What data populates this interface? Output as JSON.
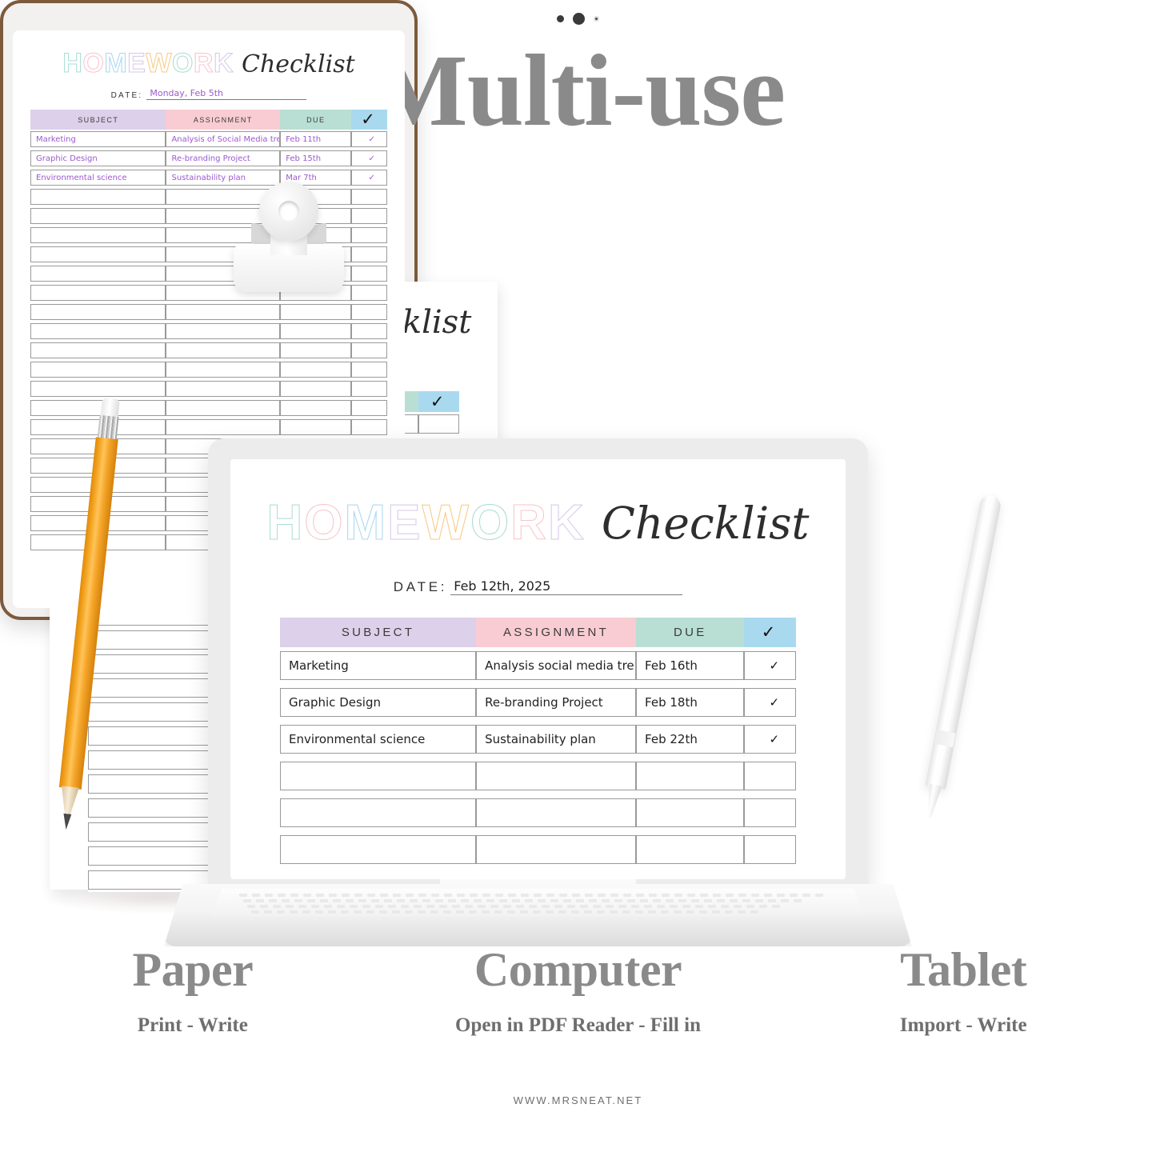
{
  "headline": "Multi-use",
  "footer": "WWW.MRSNEAT.NET",
  "brand_colors": {
    "letter_mint": "#a8ddd2",
    "letter_pink": "#f8c3cd",
    "letter_blue": "#a9d6ef",
    "letter_lavender": "#d5c7e8",
    "letter_orange": "#f8c882",
    "header_subject": "#ddd0ea",
    "header_assignment": "#f9ccd3",
    "header_due": "#b9dfd4",
    "header_check": "#a9d9ef",
    "handwriting_purple": "#9b59d0",
    "headline_gray": "#8a8a8a",
    "tablet_frame": "#7d5a3c"
  },
  "worksheet": {
    "title_letters": [
      {
        "char": "H",
        "color": "#a8ddd2"
      },
      {
        "char": "O",
        "color": "#f8c3cd"
      },
      {
        "char": "M",
        "color": "#a9d6ef"
      },
      {
        "char": "E",
        "color": "#d5c7e8"
      },
      {
        "char": "W",
        "color": "#f8c882"
      },
      {
        "char": "O",
        "color": "#a8ddd2"
      },
      {
        "char": "R",
        "color": "#f8c3cd"
      },
      {
        "char": "K",
        "color": "#d5c7e8"
      }
    ],
    "script_word": "Checklist",
    "date_label": "DATE:",
    "columns": [
      "SUBJECT",
      "ASSIGNMENT",
      "DUE",
      "✓"
    ]
  },
  "paper": {
    "caption_title": "Paper",
    "caption_sub": "Print - Write",
    "date_value": "",
    "rows": [
      {
        "subject": "",
        "assignment": "",
        "due": "",
        "done": ""
      },
      {
        "subject": "",
        "assignment": "",
        "due": "",
        "done": ""
      },
      {
        "subject": "",
        "assignment": "",
        "due": "",
        "done": ""
      },
      {
        "subject": "",
        "assignment": "",
        "due": "",
        "done": ""
      },
      {
        "subject": "",
        "assignment": "",
        "due": "",
        "done": ""
      },
      {
        "subject": "",
        "assignment": "",
        "due": "",
        "done": ""
      },
      {
        "subject": "",
        "assignment": "",
        "due": "",
        "done": ""
      },
      {
        "subject": "",
        "assignment": "",
        "due": "",
        "done": ""
      },
      {
        "subject": "",
        "assignment": "",
        "due": "",
        "done": ""
      },
      {
        "subject": "",
        "assignment": "",
        "due": "",
        "done": ""
      },
      {
        "subject": "",
        "assignment": "",
        "due": "",
        "done": ""
      },
      {
        "subject": "",
        "assignment": "",
        "due": "",
        "done": ""
      },
      {
        "subject": "",
        "assignment": "",
        "due": "",
        "done": ""
      },
      {
        "subject": "",
        "assignment": "",
        "due": "",
        "done": ""
      },
      {
        "subject": "",
        "assignment": "",
        "due": "",
        "done": ""
      },
      {
        "subject": "",
        "assignment": "",
        "due": "",
        "done": ""
      },
      {
        "subject": "",
        "assignment": "",
        "due": "",
        "done": ""
      },
      {
        "subject": "",
        "assignment": "",
        "due": "",
        "done": ""
      },
      {
        "subject": "",
        "assignment": "",
        "due": "",
        "done": ""
      },
      {
        "subject": "",
        "assignment": "",
        "due": "",
        "done": ""
      }
    ]
  },
  "computer": {
    "caption_title": "Computer",
    "caption_sub": "Open in PDF Reader - Fill in",
    "date_value": "Feb 12th, 2025",
    "rows": [
      {
        "subject": "Marketing",
        "assignment": "Analysis social media trends",
        "due": "Feb 16th",
        "done": "✓"
      },
      {
        "subject": "Graphic Design",
        "assignment": "Re-branding Project",
        "due": "Feb 18th",
        "done": "✓"
      },
      {
        "subject": "Environmental science",
        "assignment": "Sustainability plan",
        "due": "Feb 22th",
        "done": "✓"
      },
      {
        "subject": "",
        "assignment": "",
        "due": "",
        "done": ""
      },
      {
        "subject": "",
        "assignment": "",
        "due": "",
        "done": ""
      },
      {
        "subject": "",
        "assignment": "",
        "due": "",
        "done": ""
      }
    ]
  },
  "tablet": {
    "caption_title": "Tablet",
    "caption_sub": "Import - Write",
    "date_value": "Monday, Feb 5th",
    "rows": [
      {
        "subject": "Marketing",
        "assignment": "Analysis of Social Media trends",
        "due": "Feb 11th",
        "done": "✓"
      },
      {
        "subject": "Graphic Design",
        "assignment": "Re-branding Project",
        "due": "Feb 15th",
        "done": "✓"
      },
      {
        "subject": "Environmental science",
        "assignment": "Sustainability plan",
        "due": "Mar 7th",
        "done": "✓"
      },
      {
        "subject": "",
        "assignment": "",
        "due": "",
        "done": ""
      },
      {
        "subject": "",
        "assignment": "",
        "due": "",
        "done": ""
      },
      {
        "subject": "",
        "assignment": "",
        "due": "",
        "done": ""
      },
      {
        "subject": "",
        "assignment": "",
        "due": "",
        "done": ""
      },
      {
        "subject": "",
        "assignment": "",
        "due": "",
        "done": ""
      },
      {
        "subject": "",
        "assignment": "",
        "due": "",
        "done": ""
      },
      {
        "subject": "",
        "assignment": "",
        "due": "",
        "done": ""
      },
      {
        "subject": "",
        "assignment": "",
        "due": "",
        "done": ""
      },
      {
        "subject": "",
        "assignment": "",
        "due": "",
        "done": ""
      },
      {
        "subject": "",
        "assignment": "",
        "due": "",
        "done": ""
      },
      {
        "subject": "",
        "assignment": "",
        "due": "",
        "done": ""
      },
      {
        "subject": "",
        "assignment": "",
        "due": "",
        "done": ""
      },
      {
        "subject": "",
        "assignment": "",
        "due": "",
        "done": ""
      },
      {
        "subject": "",
        "assignment": "",
        "due": "",
        "done": ""
      },
      {
        "subject": "",
        "assignment": "",
        "due": "",
        "done": ""
      },
      {
        "subject": "",
        "assignment": "",
        "due": "",
        "done": ""
      },
      {
        "subject": "",
        "assignment": "",
        "due": "",
        "done": ""
      },
      {
        "subject": "",
        "assignment": "",
        "due": "",
        "done": ""
      },
      {
        "subject": "",
        "assignment": "",
        "due": "",
        "done": ""
      }
    ]
  }
}
